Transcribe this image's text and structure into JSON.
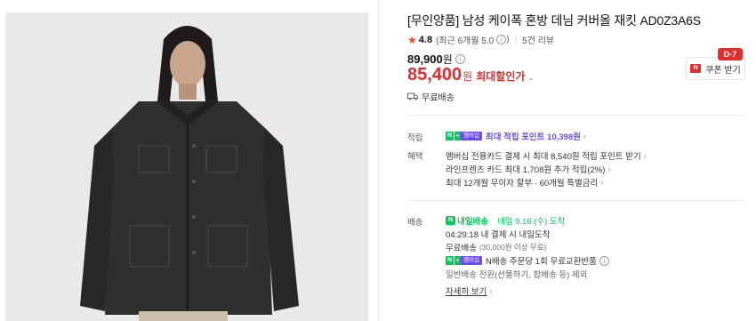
{
  "product": {
    "title": "[무인양품] 남성 케이폭 혼방 데님 커버올 재킷 AD0Z3A6S",
    "rating_score": "4.8",
    "rating_detail": "(최근 6개월 5.0",
    "rating_close": ")",
    "review_count": "5건 리뷰",
    "original_price": "89,900",
    "original_unit": "원",
    "sale_price": "85,400",
    "sale_unit": "원",
    "max_discount_label": "최대할인가",
    "shipping": "무료배송"
  },
  "coupon": {
    "dday": "D-7",
    "label": "쿠폰 받기",
    "icon": "N"
  },
  "points": {
    "label": "적립",
    "badge_n": "N",
    "badge_plus": "+",
    "badge_member": "멤버십",
    "text": "최대 적립 포인트 10,398원"
  },
  "benefits": {
    "label": "혜택",
    "lines": [
      "멤버십 전용카드 결제 시 최대 8,540원 적립 포인트 받기",
      "라인프렌즈 카드 최대 1,708원 추가 적립(2%)",
      "최대 12개월 무이자 할부 · 60개월 특별금리"
    ]
  },
  "delivery": {
    "label": "배송",
    "nextday_badge": "N",
    "nextday_label": "내일배송",
    "arrive": "내일 9.16.(수) 도착",
    "cutoff": "04:29:18 내 결제 시 내일도착",
    "free_shipping": "무료배송",
    "free_condition": "(30,000원 이상 무료)",
    "nreturn": "N배송 주문당 1회 무료교환반품",
    "exclusion": "일반배송 전환(선물하기, 합배송 등) 제외",
    "details_link": "자세히 보기"
  },
  "colors": {
    "accent_red": "#e02d2d",
    "naver_green": "#03c75a",
    "member_purple": "#6b4cf5"
  }
}
